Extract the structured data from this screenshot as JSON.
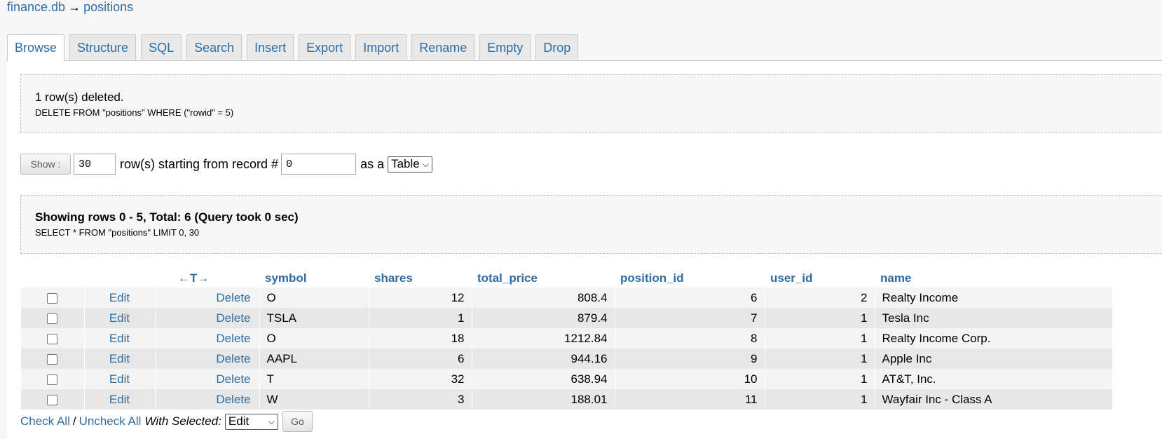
{
  "breadcrumb": {
    "db": "finance.db",
    "arrow": "→",
    "table": "positions"
  },
  "tabs": [
    "Browse",
    "Structure",
    "SQL",
    "Search",
    "Insert",
    "Export",
    "Import",
    "Rename",
    "Empty",
    "Drop"
  ],
  "message": {
    "title": "1 row(s) deleted.",
    "sql": "DELETE FROM \"positions\" WHERE (\"rowid\" = 5)"
  },
  "show": {
    "button": "Show :",
    "rows": "30",
    "text1": "row(s) starting from record #",
    "start": "0",
    "text2": "as a",
    "view": "Table"
  },
  "result": {
    "title": "Showing rows 0 - 5, Total: 6 (Query took 0 sec)",
    "sql": "SELECT * FROM \"positions\" LIMIT 0, 30"
  },
  "table": {
    "tcol": "←T→",
    "columns": [
      "symbol",
      "shares",
      "total_price",
      "position_id",
      "user_id",
      "name"
    ],
    "edit_label": "Edit",
    "delete_label": "Delete",
    "rows": [
      [
        "O",
        "12",
        "808.4",
        "6",
        "2",
        "Realty Income"
      ],
      [
        "TSLA",
        "1",
        "879.4",
        "7",
        "1",
        "Tesla Inc"
      ],
      [
        "O",
        "18",
        "1212.84",
        "8",
        "1",
        "Realty Income Corp."
      ],
      [
        "AAPL",
        "6",
        "944.16",
        "9",
        "1",
        "Apple Inc"
      ],
      [
        "T",
        "32",
        "638.94",
        "10",
        "1",
        "AT&T, Inc."
      ],
      [
        "W",
        "3",
        "188.01",
        "11",
        "1",
        "Wayfair Inc - Class A"
      ]
    ]
  },
  "footer": {
    "check_all": "Check All",
    "sep": "/",
    "uncheck_all": "Uncheck All",
    "with_selected": "With Selected:",
    "action": "Edit",
    "go": "Go"
  },
  "colors": {
    "link": "#2e6da4",
    "row_odd": "#f4f4f4",
    "row_even": "#e7e7e7"
  }
}
